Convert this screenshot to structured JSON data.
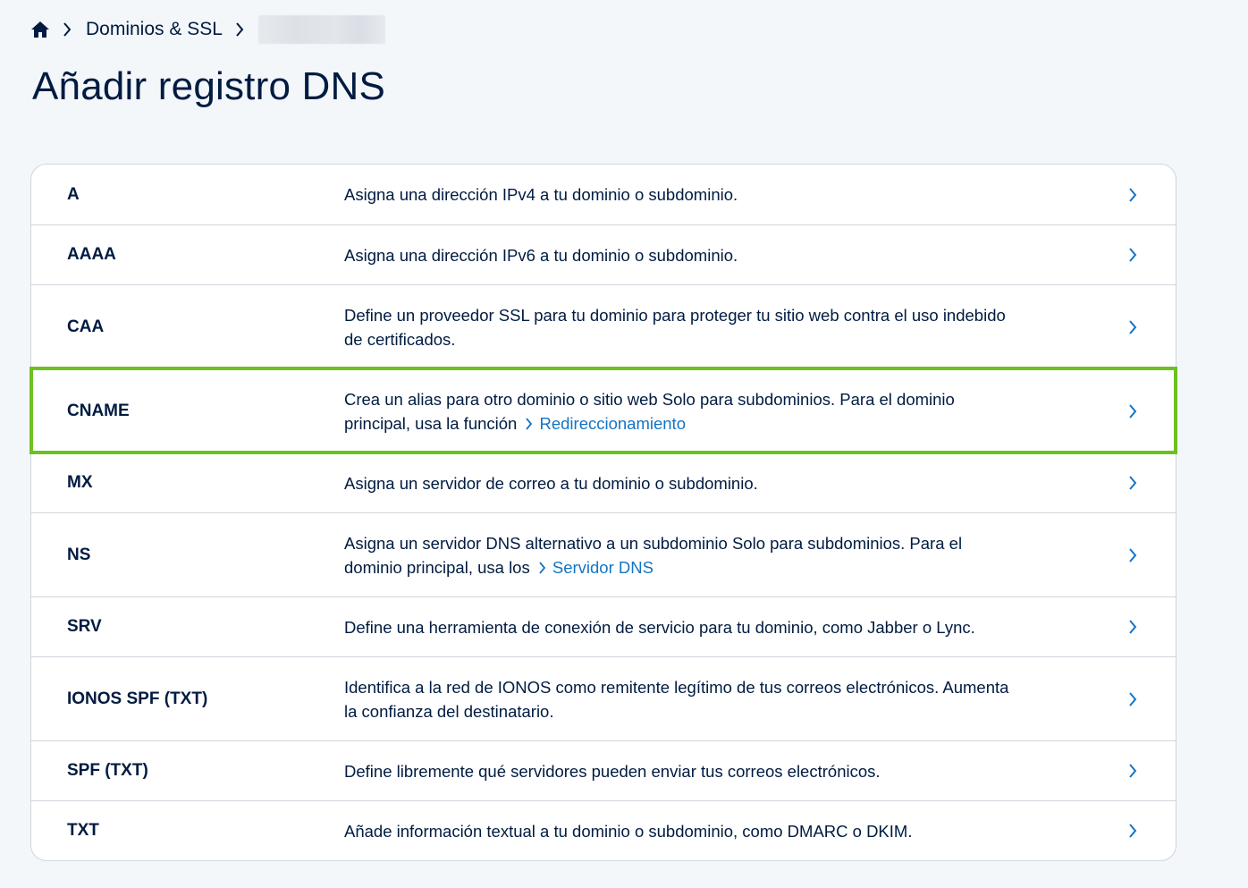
{
  "breadcrumb": {
    "home_icon": "home-icon",
    "section": "Dominios & SSL"
  },
  "page": {
    "title": "Añadir registro DNS"
  },
  "colors": {
    "accent_link": "#1474c4",
    "highlight": "#6cc11f",
    "text": "#001b41"
  },
  "records": [
    {
      "type": "A",
      "description": "Asigna una dirección IPv4 a tu dominio o subdominio."
    },
    {
      "type": "AAAA",
      "description": "Asigna una dirección IPv6 a tu dominio o subdominio."
    },
    {
      "type": "CAA",
      "description": "Define un proveedor SSL para tu dominio para proteger tu sitio web contra el uso indebido de certificados."
    },
    {
      "type": "CNAME",
      "description": "Crea un alias para otro dominio o sitio web Solo para subdominios. Para el dominio principal, usa la función",
      "link": "Redireccionamiento"
    },
    {
      "type": "MX",
      "description": "Asigna un servidor de correo a tu dominio o subdominio."
    },
    {
      "type": "NS",
      "description": "Asigna un servidor DNS alternativo a un subdominio Solo para subdominios. Para el dominio principal, usa los",
      "link": "Servidor DNS"
    },
    {
      "type": "SRV",
      "description": "Define una herramienta de conexión de servicio para tu dominio, como Jabber o Lync."
    },
    {
      "type": "IONOS SPF (TXT)",
      "description": "Identifica a la red de IONOS como remitente legítimo de tus correos electrónicos. Aumenta la confianza del destinatario."
    },
    {
      "type": "SPF (TXT)",
      "description": "Define libremente qué servidores pueden enviar tus correos electrónicos."
    },
    {
      "type": "TXT",
      "description": "Añade información textual a tu dominio o subdominio, como DMARC o DKIM."
    }
  ]
}
